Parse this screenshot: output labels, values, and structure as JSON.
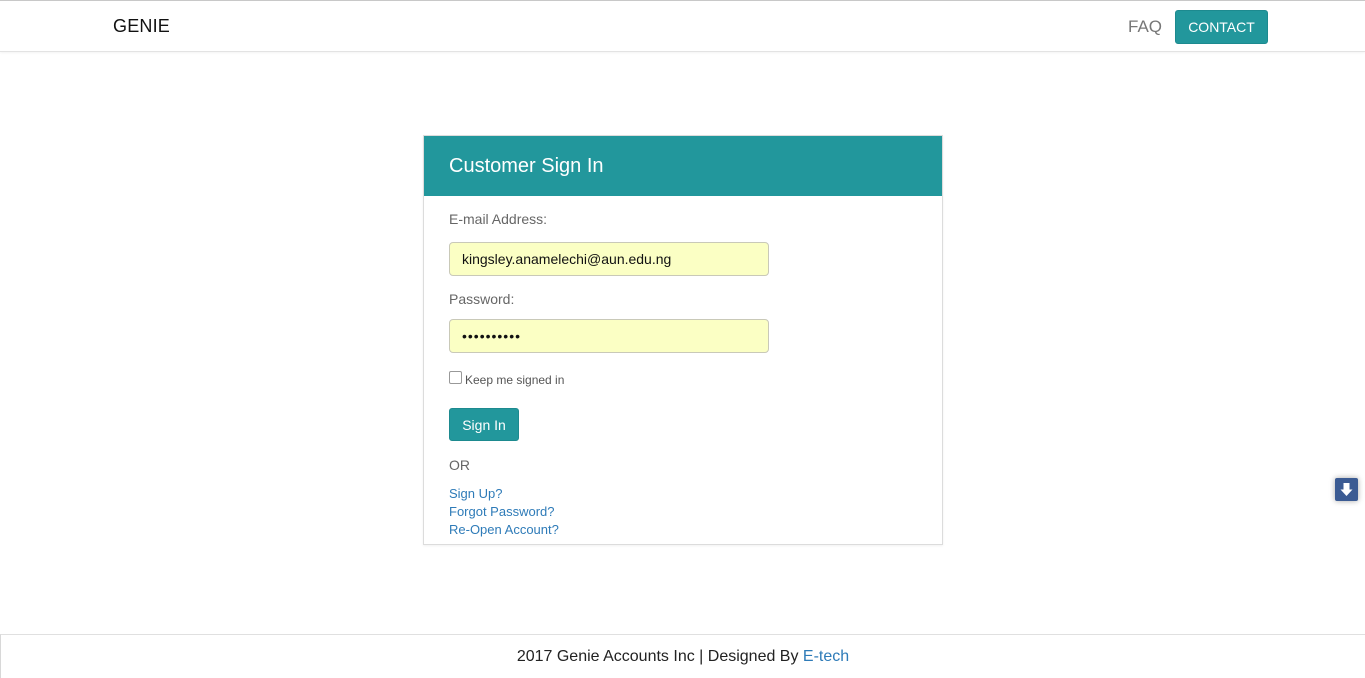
{
  "header": {
    "brand": "GENIE",
    "nav": {
      "faq": "FAQ",
      "contact": "CONTACT"
    }
  },
  "signin": {
    "title": "Customer Sign In",
    "email_label": "E-mail Address:",
    "email_value": "kingsley.anamelechi@aun.edu.ng",
    "password_label": "Password:",
    "password_value": "••••••••••",
    "keep_signed_in": "Keep me signed in",
    "keep_signed_in_checked": false,
    "submit": "Sign In",
    "or": "OR",
    "links": {
      "signup": "Sign Up?",
      "forgot": "Forgot Password?",
      "reopen": "Re-Open Account?"
    }
  },
  "scroll_button": {
    "icon": "arrow-down-icon"
  },
  "footer": {
    "text": "2017 Genie Accounts Inc | Designed By ",
    "link": "E-tech"
  },
  "colors": {
    "accent": "#22979c",
    "link": "#2e7bb8",
    "autofill": "#fbffc4",
    "scroll_button": "#3b5b93"
  }
}
